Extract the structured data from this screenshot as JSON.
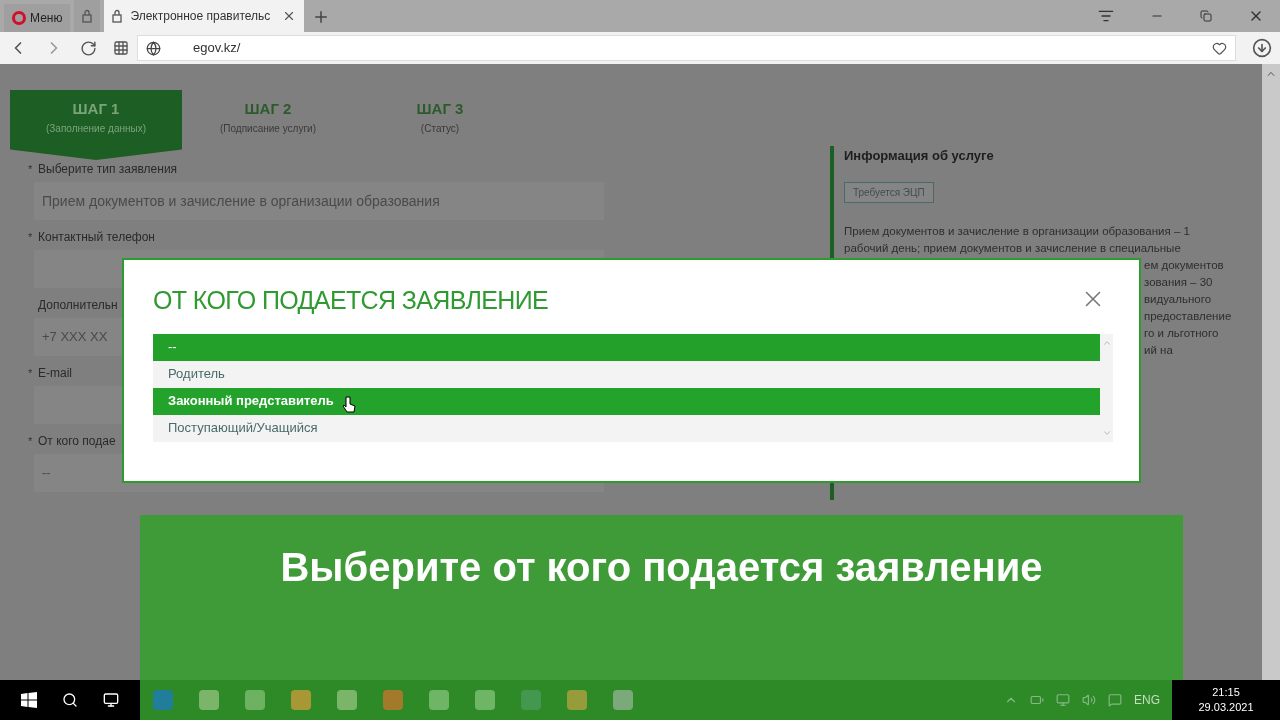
{
  "browser": {
    "menu_label": "Меню",
    "tabs": [
      {
        "kind": "pinned",
        "selected": false
      },
      {
        "kind": "page",
        "title": "Электронное правительс",
        "selected": true
      }
    ],
    "url": "egov.kz/"
  },
  "steps": [
    {
      "title": "ШАГ 1",
      "subtitle": "(Заполнение данных)",
      "selected": true
    },
    {
      "title": "ШАГ 2",
      "subtitle": "(Подписание услуги)",
      "selected": false
    },
    {
      "title": "ШАГ 3",
      "subtitle": "(Статус)",
      "selected": false
    }
  ],
  "form": [
    {
      "marker": "*",
      "label": "Выберите тип заявления",
      "value": "Прием документов и зачисление в организации образования"
    },
    {
      "marker": "*",
      "label": "Контактный телефон"
    },
    {
      "label": "Дополнительн",
      "value": "+7 XXX XX"
    },
    {
      "marker": "*",
      "label": "E-mail"
    },
    {
      "marker": "*",
      "label": "От кого подае",
      "value": "--"
    }
  ],
  "info": {
    "title": "Информация об услуге",
    "badge": "Требуется ЭЦП",
    "text": "Прием документов и зачисление в организации образования – 1 рабочий день; прием документов и зачисление в специальные",
    "fragments": [
      "ем документов",
      "зования – 30",
      "видуального",
      "предоставление",
      "го и льготного",
      "ий на"
    ]
  },
  "modal": {
    "title": "ОТ КОГО ПОДАЕТСЯ ЗАЯВЛЕНИЕ",
    "options": [
      {
        "label": "--",
        "selected": true,
        "hovered": false
      },
      {
        "label": "Родитель",
        "selected": false,
        "hovered": false
      },
      {
        "label": "Законный представитель",
        "selected": false,
        "hovered": true
      },
      {
        "label": "Поступающий/Учащийся",
        "selected": false,
        "hovered": false
      }
    ]
  },
  "caption": "Выберите от кого подается заявление",
  "taskbar": {
    "language": "ENG",
    "time": "21:15",
    "date": "29.03.2021"
  }
}
